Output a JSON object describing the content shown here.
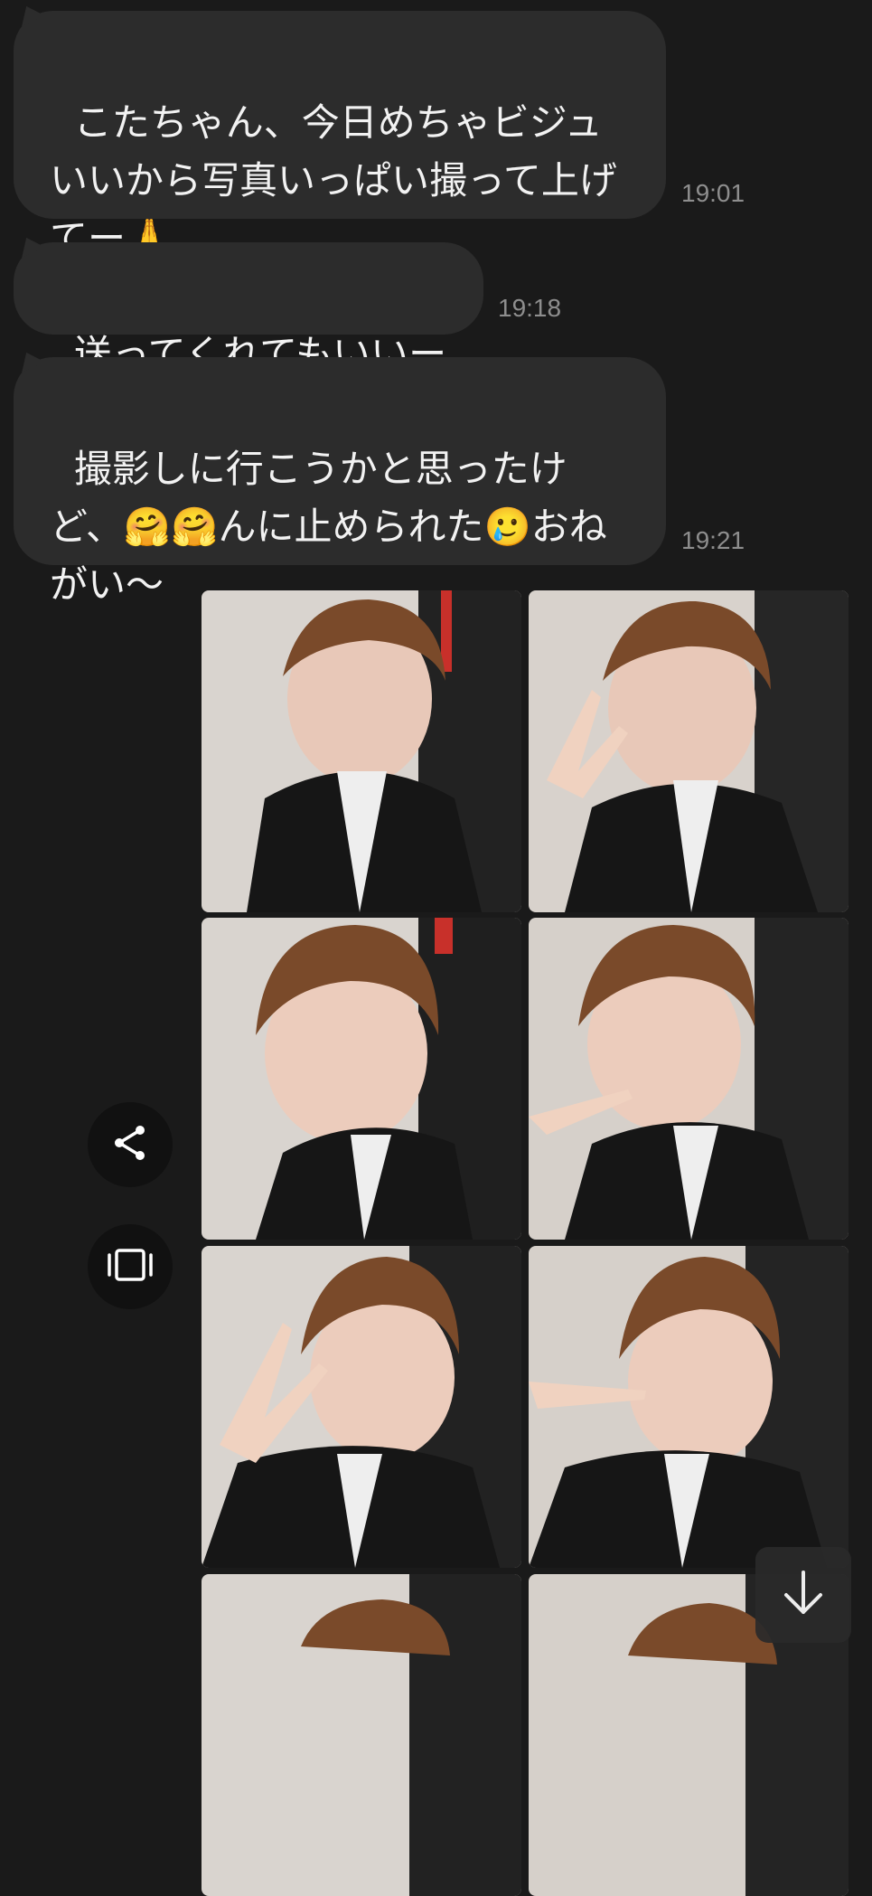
{
  "messages": [
    {
      "text": "こたちゃん、今日めちゃビジュいいから写真いっぱい撮って上げてー🙏",
      "time": "19:01"
    },
    {
      "text": "送ってくれてもいいー",
      "time": "19:18"
    },
    {
      "text": "撮影しに行こうかと思ったけど、🤗🤗んに止められた🥲おねがい〜",
      "time": "19:21"
    }
  ],
  "photo_grid": {
    "photos": [
      "photo-1",
      "photo-2",
      "photo-3",
      "photo-4",
      "photo-5",
      "photo-6",
      "photo-7",
      "photo-8"
    ]
  },
  "side_actions": {
    "share_icon": "share-icon",
    "slideshow_icon": "slideshow-icon"
  },
  "scroll_button_icon": "arrow-down-icon",
  "colors": {
    "background": "#1a1a1a",
    "bubble": "#2c2c2c",
    "text": "#f2f2f2",
    "timestamp": "#8e8e8e"
  }
}
